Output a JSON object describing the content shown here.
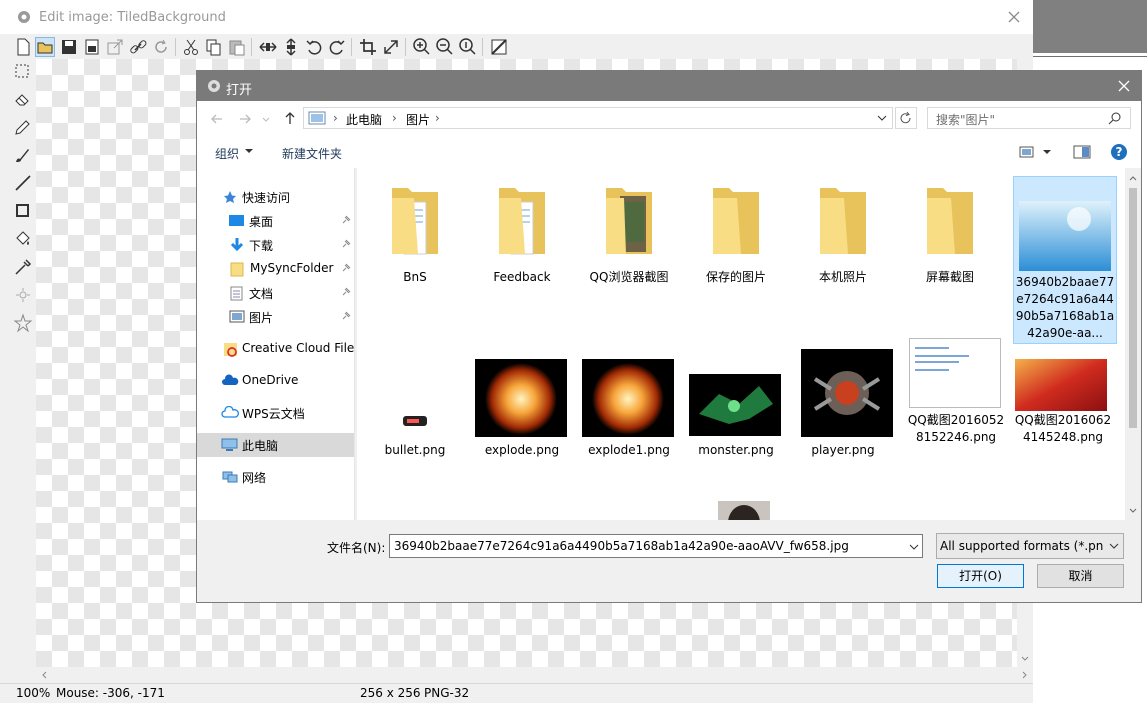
{
  "editor": {
    "title": "Edit image: TiledBackground",
    "status": {
      "zoom": "100%",
      "mouse": "Mouse: -306, -171",
      "size": "256 x 256",
      "format": "PNG-32"
    }
  },
  "dialog": {
    "title": "打开",
    "breadcrumb": [
      "此电脑",
      "图片"
    ],
    "search_placeholder": "搜索\"图片\"",
    "organize_label": "组织",
    "new_folder_label": "新建文件夹",
    "nav": {
      "quick_access": "快速访问",
      "items": [
        {
          "label": "桌面",
          "pinned": true
        },
        {
          "label": "下载",
          "pinned": true
        },
        {
          "label": "MySyncFolder",
          "pinned": true
        },
        {
          "label": "文档",
          "pinned": true
        },
        {
          "label": "图片",
          "pinned": true
        }
      ],
      "creative_cloud": "Creative Cloud Files",
      "onedrive": "OneDrive",
      "wps": "WPS云文档",
      "this_pc": "此电脑",
      "network": "网络"
    },
    "files": [
      {
        "name": "BnS",
        "kind": "folder"
      },
      {
        "name": "Feedback",
        "kind": "folder"
      },
      {
        "name": "QQ浏览器截图",
        "kind": "folder"
      },
      {
        "name": "保存的图片",
        "kind": "folder"
      },
      {
        "name": "本机照片",
        "kind": "folder"
      },
      {
        "name": "屏幕截图",
        "kind": "folder"
      },
      {
        "name": "36940b2baae77e7264c91a6a4490b5a7168ab1a42a90e-aa...",
        "kind": "image"
      },
      {
        "name": "bullet.png",
        "kind": "image"
      },
      {
        "name": "explode.png",
        "kind": "image"
      },
      {
        "name": "explode1.png",
        "kind": "image"
      },
      {
        "name": "monster.png",
        "kind": "image"
      },
      {
        "name": "player.png",
        "kind": "image"
      },
      {
        "name": "QQ截图20160528152246.png",
        "kind": "image"
      },
      {
        "name": "QQ截图20160624145248.png",
        "kind": "image"
      }
    ],
    "filename_label": "文件名(N):",
    "filename_value": "36940b2baae77e7264c91a6a4490b5a7168ab1a42a90e-aaoAVV_fw658.jpg",
    "filter_value": "All supported formats (*.png",
    "open_label": "打开(O)",
    "cancel_label": "取消"
  }
}
